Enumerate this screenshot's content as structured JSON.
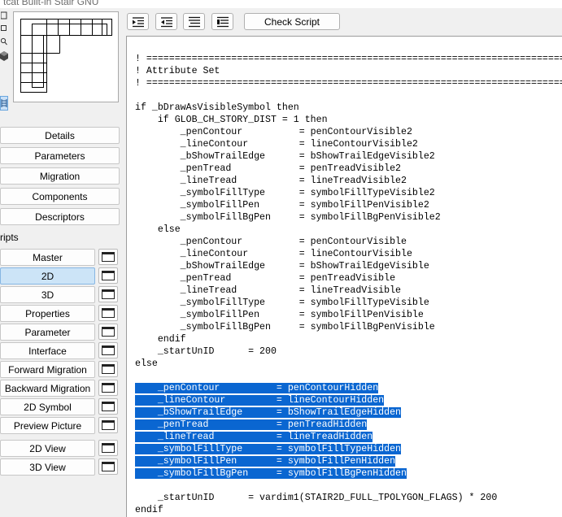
{
  "window": {
    "title": "tcat Built-in Stair GNU"
  },
  "nav": {
    "details": "Details",
    "parameters": "Parameters",
    "migration": "Migration",
    "components": "Components",
    "descriptors": "Descriptors"
  },
  "scripts": {
    "section_label": "ripts",
    "items": [
      {
        "label": "Master",
        "selected": false
      },
      {
        "label": "2D",
        "selected": true
      },
      {
        "label": "3D",
        "selected": false
      },
      {
        "label": "Properties",
        "selected": false
      },
      {
        "label": "Parameter",
        "selected": false
      },
      {
        "label": "Interface",
        "selected": false
      },
      {
        "label": "Forward Migration",
        "selected": false
      },
      {
        "label": "Backward Migration",
        "selected": false
      },
      {
        "label": "2D Symbol",
        "selected": false
      },
      {
        "label": "Preview Picture",
        "selected": false
      }
    ]
  },
  "views": {
    "view_2d": "2D View",
    "view_3d": "3D View"
  },
  "toolbar": {
    "icons": [
      "indent-icon",
      "outdent-icon",
      "comment-icon",
      "uncomment-icon"
    ],
    "check_script": "Check Script"
  },
  "code": {
    "lines": [
      "! ===========================================================================",
      "! Attribute Set",
      "! ===========================================================================",
      "",
      "if _bDrawAsVisibleSymbol then",
      "    if GLOB_CH_STORY_DIST = 1 then",
      "        _penContour          = penContourVisible2",
      "        _lineContour         = lineContourVisible2",
      "        _bShowTrailEdge      = bShowTrailEdgeVisible2",
      "        _penTread            = penTreadVisible2",
      "        _lineTread           = lineTreadVisible2",
      "        _symbolFillType      = symbolFillTypeVisible2",
      "        _symbolFillPen       = symbolFillPenVisible2",
      "        _symbolFillBgPen     = symbolFillBgPenVisible2",
      "    else",
      "        _penContour          = penContourVisible",
      "        _lineContour         = lineContourVisible",
      "        _bShowTrailEdge      = bShowTrailEdgeVisible",
      "        _penTread            = penTreadVisible",
      "        _lineTread           = lineTreadVisible",
      "        _symbolFillType      = symbolFillTypeVisible",
      "        _symbolFillPen       = symbolFillPenVisible",
      "        _symbolFillBgPen     = symbolFillBgPenVisible",
      "    endif",
      "    _startUnID      = 200",
      "else",
      "",
      "    _penContour          = penContourHidden",
      "    _lineContour         = lineContourHidden",
      "    _bShowTrailEdge      = bShowTrailEdgeHidden",
      "    _penTread            = penTreadHidden",
      "    _lineTread           = lineTreadHidden",
      "    _symbolFillType      = symbolFillTypeHidden",
      "    _symbolFillPen       = symbolFillPenHidden",
      "    _symbolFillBgPen     = symbolFillBgPenHidden",
      "",
      "    _startUnID      = vardim1(STAIR2D_FULL_TPOLYGON_FLAGS) * 200",
      "endif"
    ],
    "highlighted_lines": [
      27,
      28,
      29,
      30,
      31,
      32,
      33,
      34
    ],
    "selection_color": "#0a66d1"
  }
}
